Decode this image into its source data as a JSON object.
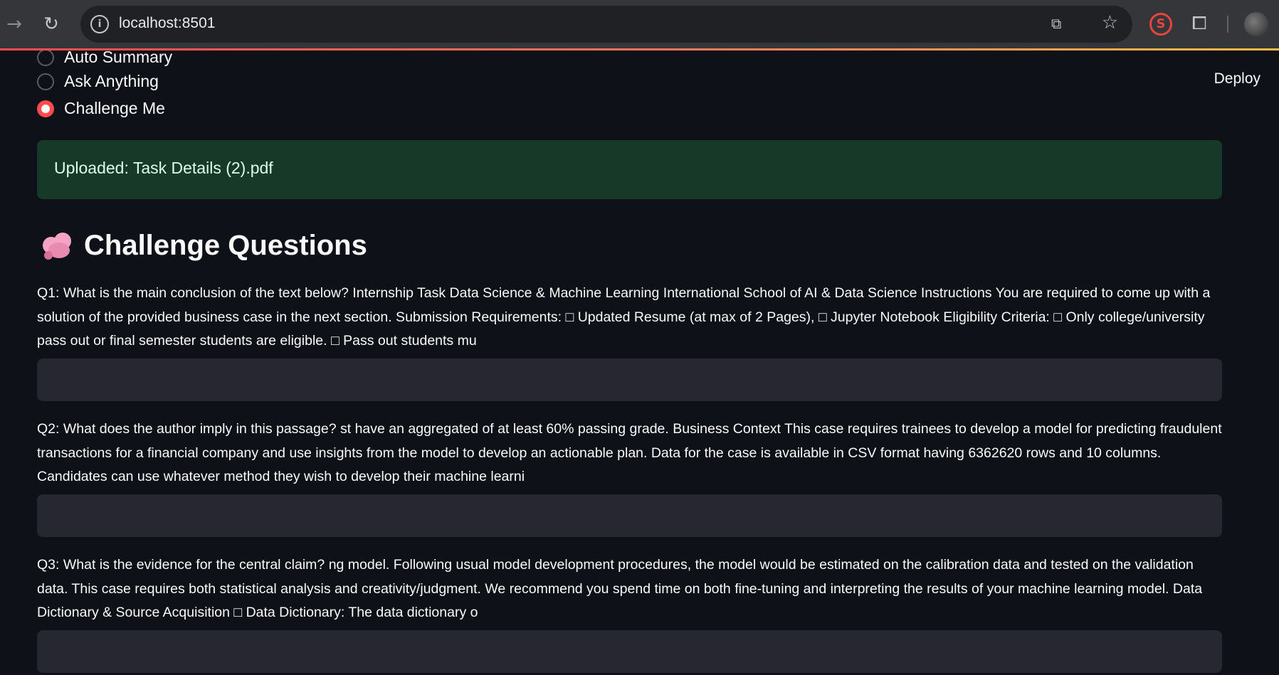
{
  "browser": {
    "url": "localhost:8501"
  },
  "header": {
    "deploy_label": "Deploy"
  },
  "mode_options": [
    {
      "label": "Auto Summary",
      "selected": false
    },
    {
      "label": "Ask Anything",
      "selected": false
    },
    {
      "label": "Challenge Me",
      "selected": true
    }
  ],
  "upload_message": "Uploaded: Task Details (2).pdf",
  "section": {
    "icon": "brain-emoji",
    "title": "Challenge Questions"
  },
  "questions": [
    {
      "text": "Q1: What is the main conclusion of the text below? Internship Task Data Science & Machine Learning International School of AI & Data Science Instructions You are required to come up with a solution of the provided business case in the next section. Submission Requirements: □ Updated Resume (at max of 2 Pages), □ Jupyter Notebook Eligibility Criteria: □ Only college/university pass out or final semester students are eligible. □ Pass out students mu",
      "answer": ""
    },
    {
      "text": "Q2: What does the author imply in this passage? st have an aggregated of at least 60% passing grade. Business Context This case requires trainees to develop a model for predicting fraudulent transactions for a financial company and use insights from the model to develop an actionable plan. Data for the case is available in CSV format having 6362620 rows and 10 columns. Candidates can use whatever method they wish to develop their machine learni",
      "answer": ""
    },
    {
      "text": "Q3: What is the evidence for the central claim? ng model. Following usual model development procedures, the model would be estimated on the calibration data and tested on the validation data. This case requires both statistical analysis and creativity/judgment. We recommend you spend time on both fine-tuning and interpreting the results of your machine learning model. Data Dictionary & Source Acquisition □ Data Dictionary: The data dictionary o",
      "answer": ""
    }
  ],
  "colors": {
    "accent": "#ff4b4b",
    "background": "#0e1117",
    "success_bg": "#173928",
    "input_bg": "#262730"
  }
}
